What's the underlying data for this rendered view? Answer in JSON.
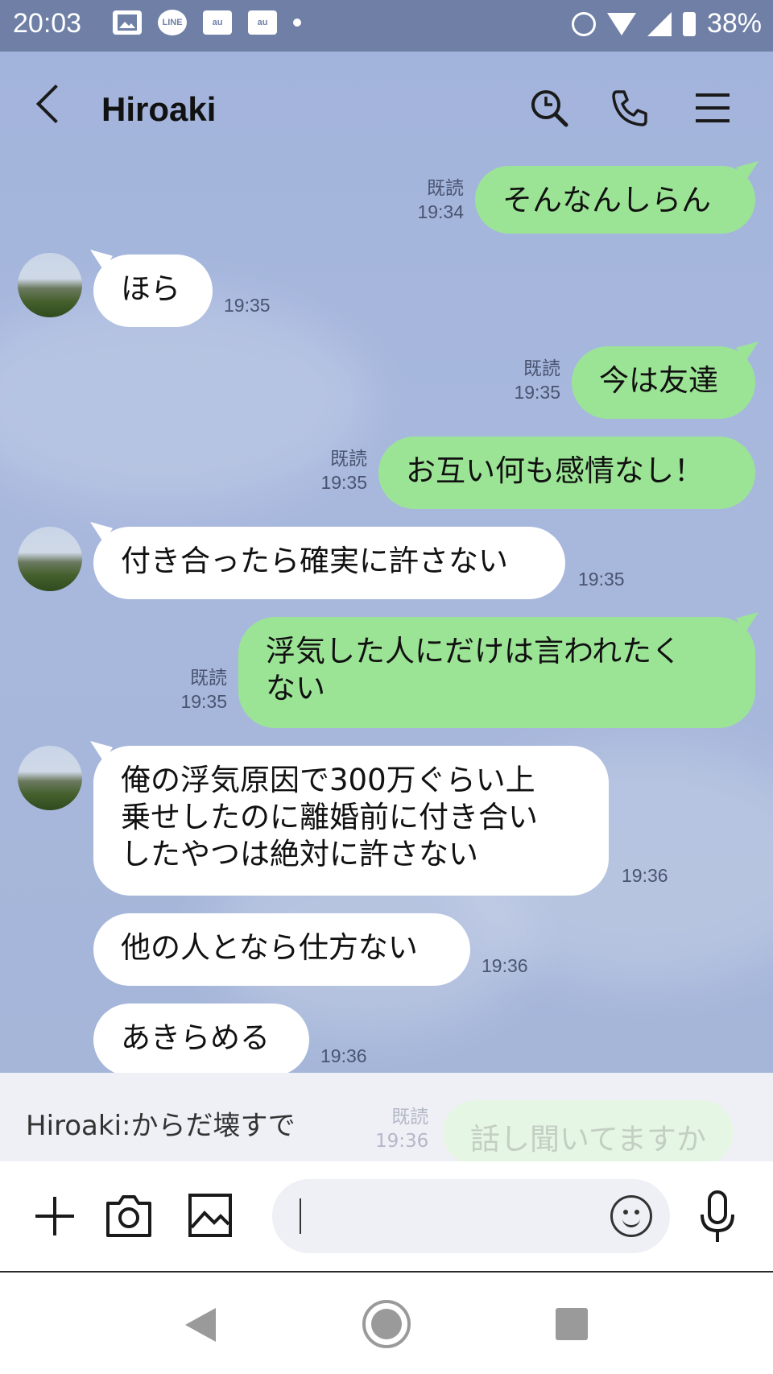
{
  "status_bar": {
    "time": "20:03",
    "notification_icons": [
      "image-icon",
      "line-icon",
      "au-mail-icon",
      "au-mail-icon",
      "dot-icon"
    ],
    "line_label": "LINE",
    "mail_label": "au",
    "battery": "38%"
  },
  "header": {
    "title": "Hiroaki"
  },
  "messages": [
    {
      "side": "out",
      "text": "そんなんしらん",
      "read": "既読",
      "time": "19:34"
    },
    {
      "side": "in",
      "text": "ほら",
      "time": "19:35"
    },
    {
      "side": "out",
      "text": "今は友達",
      "read": "既読",
      "time": "19:35"
    },
    {
      "side": "out",
      "text": "お互い何も感情なし！",
      "read": "既読",
      "time": "19:35"
    },
    {
      "side": "in",
      "text": "付き合ったら確実に許さない",
      "time": "19:35"
    },
    {
      "side": "out",
      "text": "浮気した人にだけは言われたく\nない",
      "read": "既読",
      "time": "19:35"
    },
    {
      "side": "in",
      "text": "俺の浮気原因で300万ぐらい上\n乗せしたのに離婚前に付き合い\nしたやつは絶対に許さない",
      "time": "19:36"
    },
    {
      "side": "in",
      "text": "他の人となら仕方ない",
      "time": "19:36"
    },
    {
      "side": "in",
      "text": "あきらめる",
      "time": "19:36"
    }
  ],
  "preview": {
    "text": "Hiroaki:からだ壊すで",
    "ghost_read": "既読",
    "ghost_time": "19:36",
    "ghost_text": "話し聞いてますか"
  },
  "input": {
    "placeholder": ""
  },
  "colors": {
    "chat_bg": "#a3b4dc",
    "bubble_out": "#9ce495",
    "bubble_in": "#ffffff",
    "status_bar": "#6f7fa6"
  }
}
